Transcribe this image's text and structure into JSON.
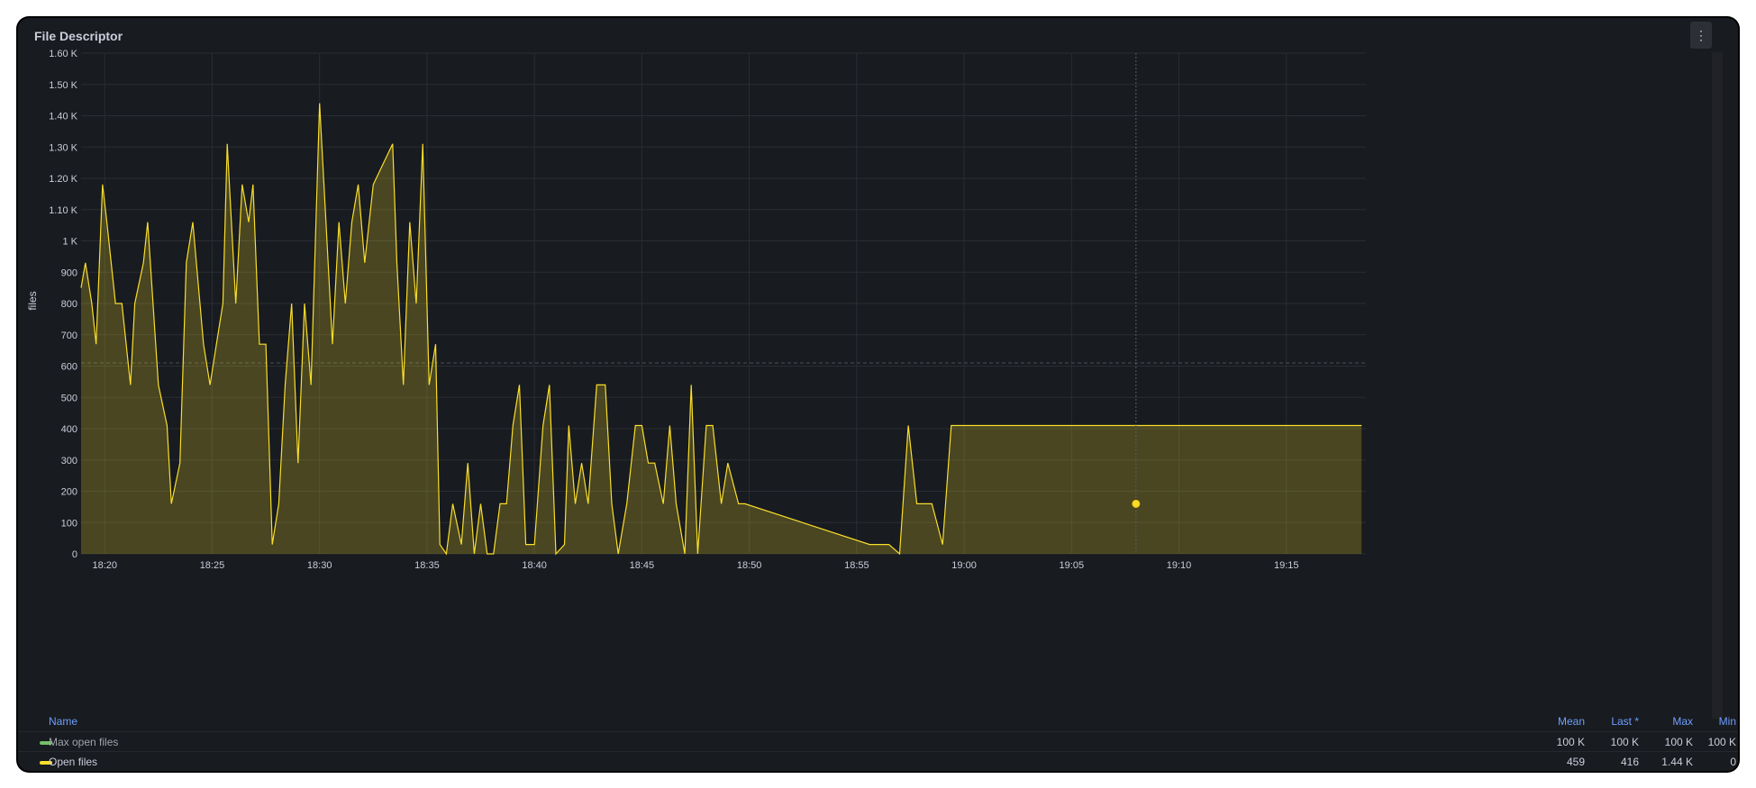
{
  "panel": {
    "title": "File Descriptor",
    "menu_icon": "⋮"
  },
  "legend": {
    "headers": {
      "name": "Name",
      "mean": "Mean",
      "last": "Last *",
      "max": "Max",
      "min": "Min"
    },
    "rows": [
      {
        "name": "Max open files",
        "color": "#73bf69",
        "mean": "100 K",
        "last": "100 K",
        "max": "100 K",
        "min": "100 K"
      },
      {
        "name": "Open files",
        "color": "#fade2a",
        "mean": "459",
        "last": "416",
        "max": "1.44 K",
        "min": "0"
      }
    ]
  },
  "chart_data": {
    "type": "area",
    "title": "File Descriptor",
    "ylabel": "files",
    "xlabel": "",
    "ylim": [
      0,
      1600
    ],
    "yticks": [
      "0",
      "100",
      "200",
      "300",
      "400",
      "500",
      "600",
      "700",
      "800",
      "900",
      "1 K",
      "1.10 K",
      "1.20 K",
      "1.30 K",
      "1.40 K",
      "1.50 K",
      "1.60 K"
    ],
    "xticks": [
      "18:20",
      "18:25",
      "18:30",
      "18:35",
      "18:40",
      "18:45",
      "18:50",
      "18:55",
      "19:00",
      "19:05",
      "19:10",
      "19:15"
    ],
    "xticks_minutes": [
      20,
      25,
      30,
      35,
      40,
      45,
      50,
      55,
      60,
      65,
      70,
      75
    ],
    "xrange_minutes": [
      18.9,
      78.7
    ],
    "grid": true,
    "legend_position": "bottom",
    "threshold_line": 610,
    "hover_point": {
      "time": "19:08",
      "x": 68.0,
      "y": 160
    },
    "series": [
      {
        "name": "Open files",
        "color": "#fade2a",
        "x": [
          18.9,
          19.1,
          19.4,
          19.6,
          19.9,
          20.1,
          20.3,
          20.5,
          20.8,
          21.2,
          21.4,
          21.8,
          22.0,
          22.5,
          22.9,
          23.1,
          23.5,
          23.8,
          24.1,
          24.6,
          24.9,
          25.2,
          25.5,
          25.7,
          26.1,
          26.4,
          26.7,
          26.9,
          27.2,
          27.5,
          27.8,
          28.1,
          28.4,
          28.7,
          29.0,
          29.3,
          29.6,
          30.0,
          30.3,
          30.6,
          30.9,
          31.2,
          31.5,
          31.8,
          32.1,
          32.5,
          33.4,
          33.6,
          33.9,
          34.2,
          34.5,
          34.8,
          35.1,
          35.4,
          35.6,
          35.9,
          36.2,
          36.6,
          36.9,
          37.2,
          37.5,
          37.8,
          38.1,
          38.4,
          38.7,
          39.0,
          39.3,
          39.6,
          40.0,
          40.4,
          40.7,
          41.0,
          41.4,
          41.6,
          41.9,
          42.2,
          42.5,
          42.9,
          43.3,
          43.6,
          43.9,
          44.3,
          44.7,
          45.0,
          45.3,
          45.6,
          46.0,
          46.3,
          46.6,
          47.0,
          47.3,
          47.6,
          48.0,
          48.3,
          48.7,
          49.0,
          49.5,
          49.8,
          55.6,
          56.1,
          56.5,
          57.0,
          57.4,
          57.8,
          58.0,
          58.5,
          59.0,
          59.4,
          59.9,
          60.2,
          60.5,
          60.8,
          61.3,
          61.6,
          62.0,
          62.3,
          62.6,
          62.9,
          63.3,
          63.6,
          64.1,
          64.5,
          64.9,
          65.1,
          65.6,
          65.9,
          66.4,
          67.2,
          67.7,
          68.1,
          68.4,
          68.7,
          69.1,
          69.4,
          69.7,
          70.0,
          70.3,
          70.6,
          71.1,
          71.4,
          71.8,
          72.1,
          72.4,
          72.7,
          73.2,
          73.5,
          73.8,
          74.1,
          74.9,
          75.4,
          75.7,
          76.0,
          76.3,
          77.5,
          77.8,
          78.2,
          78.5
        ]
      }
    ]
  }
}
